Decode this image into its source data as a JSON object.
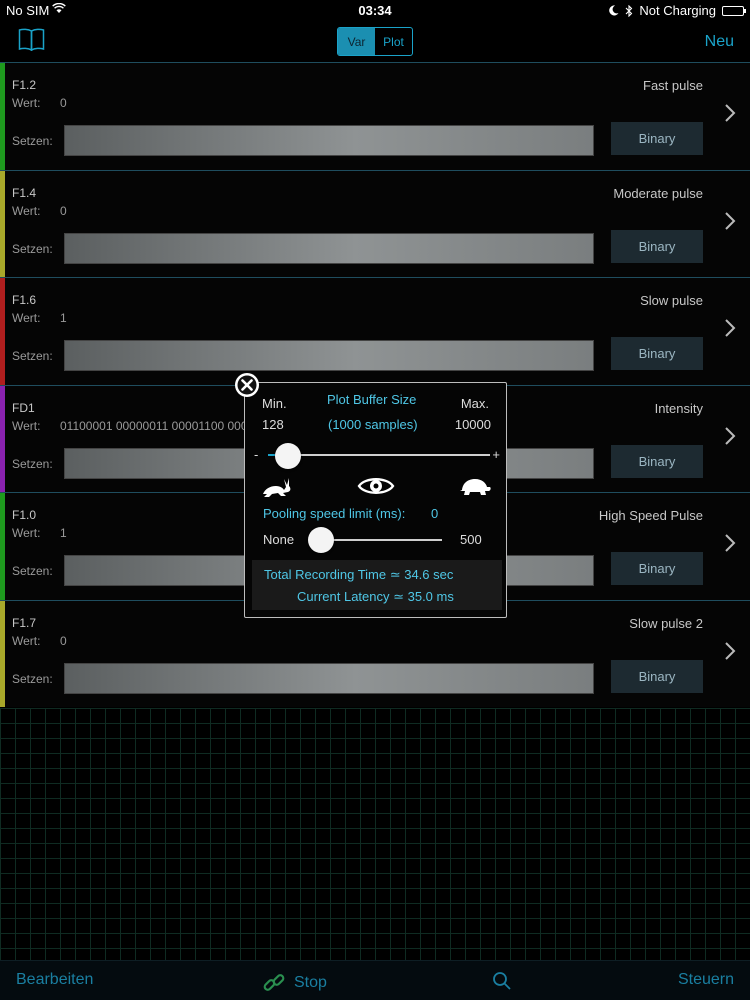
{
  "status_bar": {
    "carrier": "No SIM",
    "time": "03:34",
    "charging": "Not Charging"
  },
  "navbar": {
    "segments": [
      "Var",
      "Plot"
    ],
    "selected_segment": "Var",
    "new_label": "Neu"
  },
  "labels": {
    "wert": "Wert:",
    "setzen": "Setzen:",
    "binary": "Binary"
  },
  "rows": [
    {
      "name": "F1.2",
      "value": "0",
      "description": "Fast pulse",
      "color": "#1e9a1e"
    },
    {
      "name": "F1.4",
      "value": "0",
      "description": "Moderate pulse",
      "color": "#a8a82a"
    },
    {
      "name": "F1.6",
      "value": "1",
      "description": "Slow pulse",
      "color": "#b01e1e"
    },
    {
      "name": "FD1",
      "value": "01100001 00000011 00001100 00000100",
      "description": "Intensity",
      "color": "#8a22b0"
    },
    {
      "name": "F1.0",
      "value": "1",
      "description": "High Speed Pulse",
      "color": "#1e9a1e"
    },
    {
      "name": "F1.7",
      "value": "0",
      "description": "Slow pulse 2",
      "color": "#a8a82a"
    }
  ],
  "popup": {
    "title": "Plot Buffer Size",
    "samples": "(1000 samples)",
    "min_label": "Min.",
    "min_value": "128",
    "max_label": "Max.",
    "max_value": "10000",
    "minus": "-",
    "plus": "+",
    "buffer_slider_fraction": 0.09,
    "pooling_label": "Pooling speed limit (ms):",
    "pooling_value": "0",
    "none_label": "None",
    "max_pool_label": "500",
    "recording_time": "Total Recording Time ≃  34.6 sec",
    "latency": "Current Latency ≃  35.0 ms",
    "icons": [
      "close-icon",
      "rabbit-icon",
      "eye-icon",
      "turtle-icon"
    ]
  },
  "toolbar": {
    "edit": "Bearbeiten",
    "stop": "Stop",
    "control": "Steuern",
    "accent": "#1a7fa1"
  }
}
